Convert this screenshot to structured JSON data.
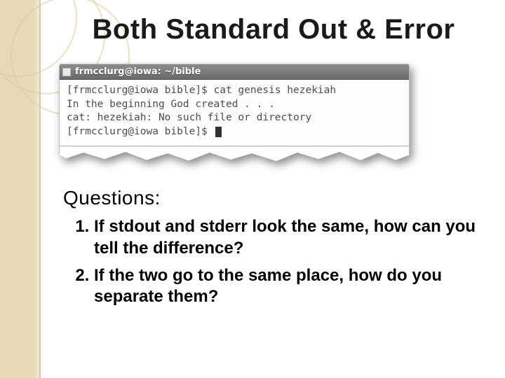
{
  "title": "Both Standard Out & Error",
  "terminal": {
    "window_title": "frmcclurg@iowa: ~/bible",
    "lines": {
      "l1_prompt": "[frmcclurg@iowa bible]$ ",
      "l1_cmd": "cat genesis hezekiah",
      "l2": "In the beginning God created . . .",
      "l3": "cat: hezekiah: No such file or directory",
      "l4_prompt": "[frmcclurg@iowa bible]$ "
    }
  },
  "questions_label": "Questions:",
  "questions": {
    "q1": "If stdout and stderr look the same, how can you tell the difference?",
    "q2": "If the two go to the same place, how do you separate them?"
  }
}
